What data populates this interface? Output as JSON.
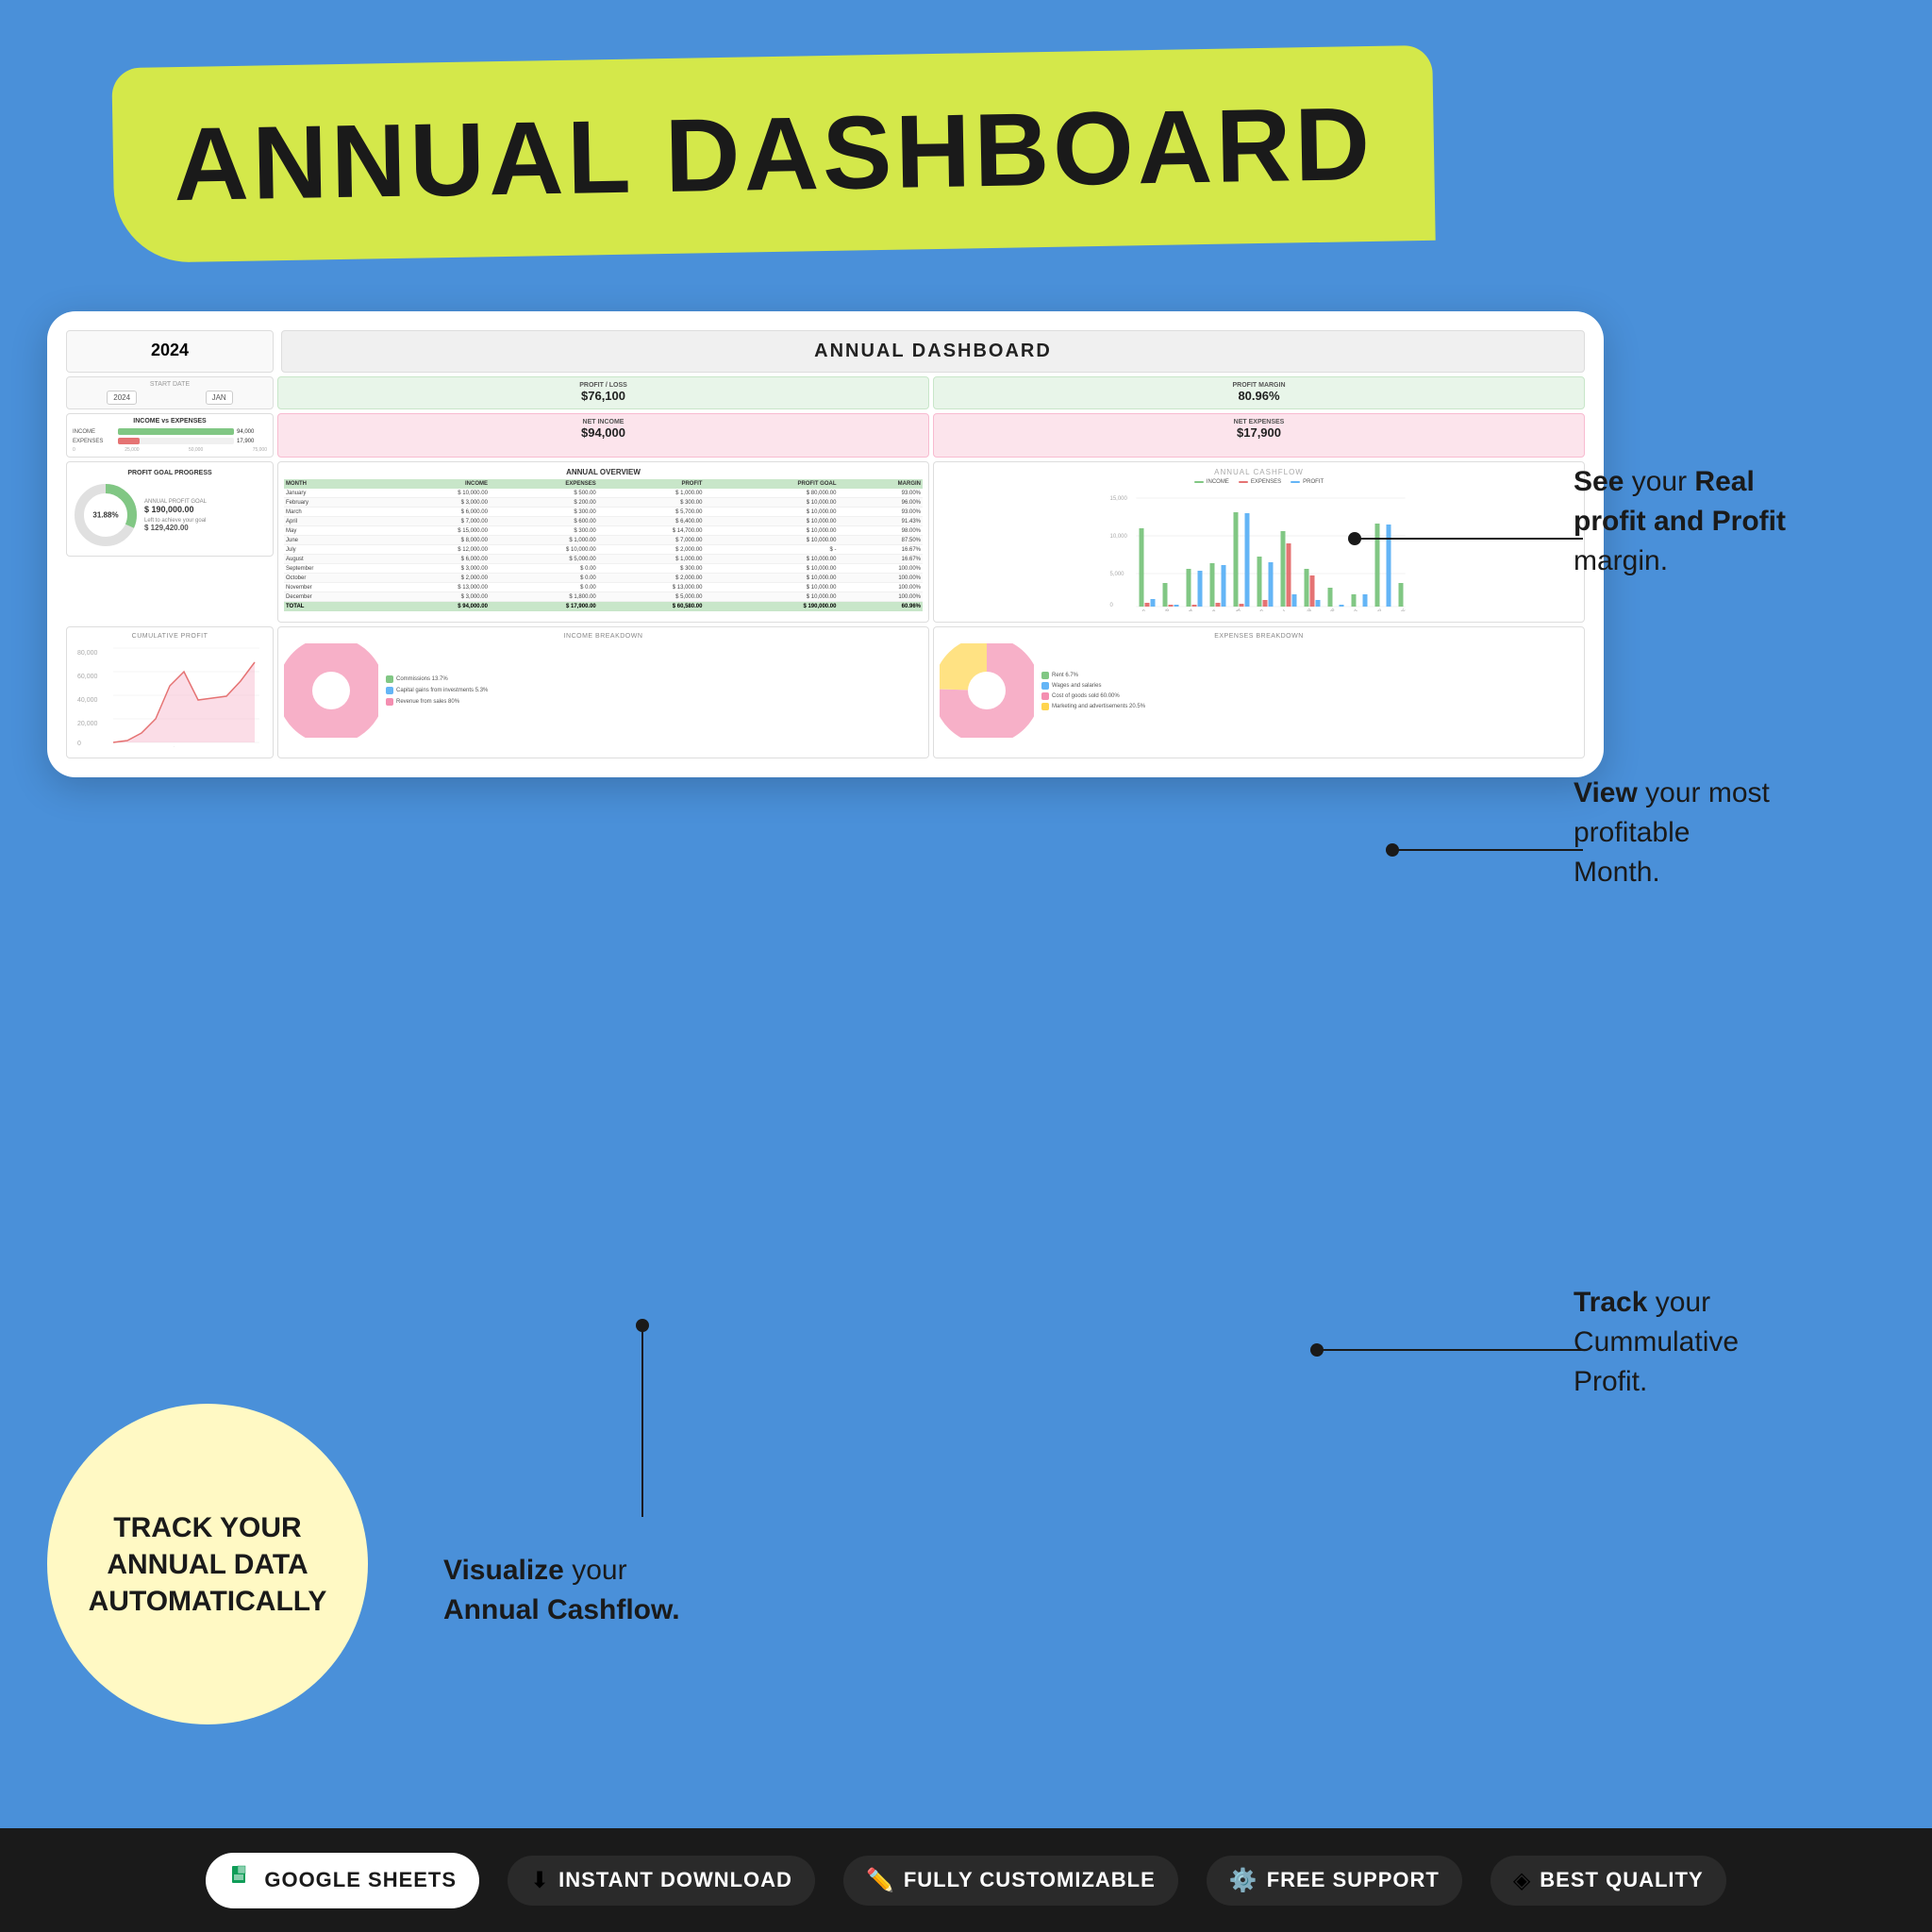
{
  "header": {
    "title": "ANNUAL DASHBOARD",
    "background_color": "#4A90D9",
    "banner_color": "#D4E84A"
  },
  "dashboard": {
    "year": "2024",
    "title": "ANNUAL DASHBOARD",
    "start_date_label": "START DATE",
    "start_date_value": "2024",
    "start_month": "JAN",
    "metrics": {
      "profit_loss": {
        "label": "PROFIT / LOSS",
        "value": "$76,100"
      },
      "profit_margin": {
        "label": "PROFIT MARGIN",
        "value": "80.96%"
      },
      "net_income": {
        "label": "NET INCOME",
        "value": "$94,000"
      },
      "net_expenses": {
        "label": "NET EXPENSES",
        "value": "$17,900"
      }
    },
    "income_vs_expenses": {
      "title": "INCOME vs EXPENSES",
      "income_label": "INCOME",
      "income_value": "94,000",
      "expenses_label": "EXPENSES",
      "expenses_value": "17,900"
    },
    "profit_goal": {
      "title": "PROFIT GOAL PROGRESS",
      "annual_profit_goal_label": "ANNUAL PROFIT GOAL",
      "annual_profit_goal_value": "$ 190,000.00",
      "percentage": "31.88%",
      "left_to_achieve_label": "Left to achieve your goal",
      "left_to_achieve_value": "$ 129,420.00"
    },
    "annual_overview": {
      "title": "ANNUAL OVERVIEW",
      "columns": [
        "MONTH",
        "INCOME",
        "EXPENSES",
        "PROFIT",
        "PROFIT GOAL",
        "MARGIN"
      ],
      "rows": [
        [
          "January",
          "$ 10,000.00",
          "$ 500.00",
          "$ 1,000.00",
          "$ 80,000.00",
          "93.00%"
        ],
        [
          "February",
          "$ 3,000.00",
          "$ 200.00",
          "$ 300.00",
          "$ 10,000.00",
          "96.00%"
        ],
        [
          "March",
          "$ 6,000.00",
          "$ 300.00",
          "$ 5,700.00",
          "$ 10,000.00",
          "93.00%"
        ],
        [
          "April",
          "$ 7,000.00",
          "$ 600.00",
          "$ 6,400.00",
          "$ 10,000.00",
          "91.43%"
        ],
        [
          "May",
          "$ 15,000.00",
          "$ 300.00",
          "$ 14,700.00",
          "$ 10,000.00",
          "98.00%"
        ],
        [
          "June",
          "$ 8,000.00",
          "$ 1,000.00",
          "$ 7,000.00",
          "$ 10,000.00",
          "87.50%"
        ],
        [
          "July",
          "$ 12,000.00",
          "$ 10,000.00",
          "$ 2,000.00",
          "$ -",
          "16.67%"
        ],
        [
          "August",
          "$ 6,000.00",
          "$ 5,000.00",
          "$ 1,000.00",
          "$ 10,000.00",
          "16.67%"
        ],
        [
          "September",
          "$ 3,000.00",
          "$ 0.00",
          "$ 300.00",
          "$ 10,000.00",
          "100.00%"
        ],
        [
          "October",
          "$ 2,000.00",
          "$ 0.00",
          "$ 2,000.00",
          "$ 10,000.00",
          "100.00%"
        ],
        [
          "November",
          "$ 13,000.00",
          "$ 0.00",
          "$ 13,000.00",
          "$ 10,000.00",
          "100.00%"
        ],
        [
          "December",
          "$ 3,000.00",
          "$ 1,800.00",
          "$ 5,000.00",
          "$ 10,000.00",
          "100.00%"
        ]
      ],
      "total": [
        "TOTAL",
        "$ 94,000.00",
        "$ 17,900.00",
        "$ 60,580.00",
        "$ 190,000.00",
        "60.96%"
      ]
    },
    "annual_cashflow": {
      "title": "ANNUAL CASHFLOW",
      "legend": [
        {
          "label": "INCOME",
          "color": "#81C784"
        },
        {
          "label": "EXPENSES",
          "color": "#E57373"
        },
        {
          "label": "PROFIT",
          "color": "#64B5F6"
        }
      ],
      "months": [
        "January",
        "February",
        "March",
        "April",
        "May",
        "June",
        "July",
        "August",
        "September",
        "October",
        "November",
        "December"
      ]
    },
    "cumulative_profit": {
      "title": "CUMULATIVE PROFIT",
      "y_axis": [
        "80,000",
        "60,000",
        "40,000",
        "20,000",
        "0"
      ]
    },
    "income_breakdown": {
      "title": "INCOME BREAKDOWN",
      "segments": [
        {
          "label": "Commissions",
          "percent": "13.7%",
          "color": "#81C784"
        },
        {
          "label": "Capital gains from investments",
          "percent": "5.3%",
          "color": "#64B5F6"
        },
        {
          "label": "Revenue from sales",
          "percent": "80%",
          "color": "#f48fb1"
        }
      ]
    },
    "expenses_breakdown": {
      "title": "EXPENSES BREAKDOWN",
      "segments": [
        {
          "label": "Rent",
          "percent": "6.7%",
          "color": "#81C784"
        },
        {
          "label": "Wages and salaries",
          "percent": "",
          "color": "#64B5F6"
        },
        {
          "label": "Cost of goods sold",
          "percent": "60.00%",
          "color": "#f48fb1"
        },
        {
          "label": "Marketing and advertisements",
          "percent": "20.5%",
          "color": "#FFD54F"
        }
      ]
    }
  },
  "callouts": {
    "profit_margin": {
      "line1": "See your Real",
      "line2": "profit and Profit",
      "line3": "margin."
    },
    "most_profitable": {
      "line1": "View your most",
      "line2": "profitable",
      "line3": "Month."
    },
    "track_cumulative": {
      "line1": "Track your",
      "line2": "Cummulative",
      "line3": "Profit."
    },
    "visualize": {
      "line1": "Visualize your",
      "line2": "Annual Cashflow."
    }
  },
  "yellow_circle": {
    "text": "TRACK YOUR\nANNUAL DATA\nAUTOMATICALLY",
    "background": "#FFF9C4"
  },
  "bottom_bar": {
    "background": "#1a1a1a",
    "badges": [
      {
        "icon": "📊",
        "text": "Google Sheets",
        "white_bg": true
      },
      {
        "icon": "⬇",
        "text": "INSTANT DOWNLOAD",
        "white_bg": false
      },
      {
        "icon": "✏",
        "text": "FULLY CUSTOMIZABLE",
        "white_bg": false
      },
      {
        "icon": "⚙",
        "text": "FREE SUPPORT",
        "white_bg": false
      },
      {
        "icon": "◈",
        "text": "BEST QUALITY",
        "white_bg": false
      }
    ]
  }
}
